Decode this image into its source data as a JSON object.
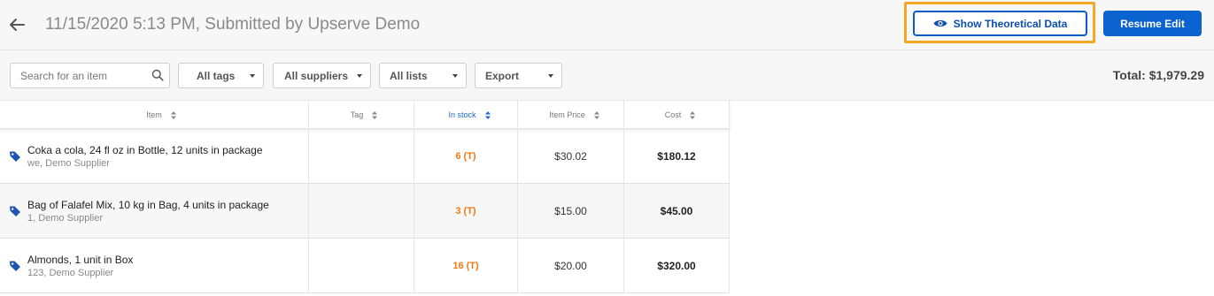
{
  "header": {
    "title": "11/15/2020 5:13 PM, Submitted by Upserve Demo",
    "show_theoretical_label": "Show Theoretical Data",
    "resume_edit_label": "Resume Edit"
  },
  "toolbar": {
    "search_placeholder": "Search for an item",
    "filters": {
      "tags": "All tags",
      "suppliers": "All suppliers",
      "lists": "All lists",
      "export": "Export"
    },
    "total": "Total: $1,979.29"
  },
  "table": {
    "columns": {
      "item": "Item",
      "tag": "Tag",
      "in_stock": "In stock",
      "item_price": "Item Price",
      "cost": "Cost"
    },
    "rows": [
      {
        "name": "Coka a cola, 24 fl oz in Bottle, 12 units in package",
        "supplier": "we, Demo Supplier",
        "in_stock": "6 (T)",
        "price": "$30.02",
        "cost": "$180.12"
      },
      {
        "name": "Bag of Falafel Mix, 10 kg in Bag, 4 units in package",
        "supplier": "1, Demo Supplier",
        "in_stock": "3 (T)",
        "price": "$15.00",
        "cost": "$45.00"
      },
      {
        "name": "Almonds, 1 unit in Box",
        "supplier": "123, Demo Supplier",
        "in_stock": "16 (T)",
        "price": "$20.00",
        "cost": "$320.00"
      }
    ]
  },
  "colors": {
    "primary_blue": "#0b63cf",
    "highlight_orange": "#f5a623",
    "stock_orange": "#ee7b12"
  }
}
